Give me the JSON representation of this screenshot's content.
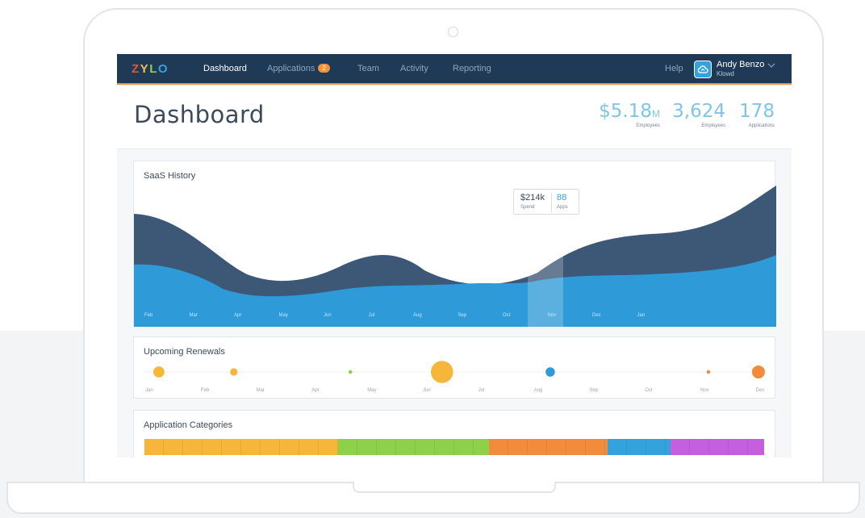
{
  "brand": {
    "logo_letters": [
      "Z",
      "Y",
      "L",
      "O"
    ],
    "logo_colors": [
      "#e9532f",
      "#f5c242",
      "#8ed04a",
      "#34a3dd"
    ]
  },
  "nav": {
    "items": [
      {
        "label": "Dashboard",
        "active": true
      },
      {
        "label": "Applications",
        "badge": "2"
      },
      {
        "label": "Team"
      },
      {
        "label": "Activity"
      },
      {
        "label": "Reporting"
      }
    ],
    "help": "Help",
    "user": {
      "name": "Andy Benzo",
      "org": "Klowd",
      "avatar_icon": "cloud-icon"
    },
    "accent": "#f0943c"
  },
  "header": {
    "title": "Dashboard",
    "stats": [
      {
        "value": "$5.18",
        "unit": "M",
        "label": "Employees"
      },
      {
        "value": "3,624",
        "label": "Employees"
      },
      {
        "value": "178",
        "label": "Applications"
      }
    ]
  },
  "saas_history": {
    "title": "SaaS History",
    "months": [
      "Feb",
      "Mar",
      "Apr",
      "May",
      "Jun",
      "Jul",
      "Aug",
      "Sep",
      "Oct",
      "Nov",
      "Dec",
      "Jan"
    ],
    "tooltip": {
      "spend_value": "$214k",
      "spend_label": "Spend",
      "apps_value": "88",
      "apps_label": "Apps"
    },
    "colors": {
      "spend": "#3d5877",
      "apps": "#2f9ad8"
    }
  },
  "renewals": {
    "title": "Upcoming Renewals",
    "months": [
      "Jan",
      "Feb",
      "Mar",
      "Apr",
      "May",
      "Jun",
      "Jul",
      "Aug",
      "Sep",
      "Oct",
      "Nov",
      "Dec"
    ]
  },
  "categories": {
    "title": "Application Categories",
    "colors": [
      "#f6b63a",
      "#8ed04a",
      "#f28c3c",
      "#34a3dd",
      "#c45fe0"
    ]
  },
  "chart_data": [
    {
      "type": "area",
      "title": "SaaS History",
      "categories": [
        "Feb",
        "Mar",
        "Apr",
        "May",
        "Jun",
        "Jul",
        "Aug",
        "Sep",
        "Oct",
        "Nov",
        "Dec",
        "Jan"
      ],
      "highlight": "Nov",
      "tooltip": {
        "Spend": "$214k",
        "Apps": "88"
      }
    },
    {
      "type": "scatter",
      "title": "Upcoming Renewals",
      "categories": [
        "Jan",
        "Feb",
        "Mar",
        "Apr",
        "May",
        "Jun",
        "Jul",
        "Aug",
        "Sep",
        "Oct",
        "Nov",
        "Dec"
      ],
      "points": [
        {
          "month": 0.1,
          "size": 3,
          "color": "#f6b63a"
        },
        {
          "month": 1.45,
          "size": 2,
          "color": "#f6b63a"
        },
        {
          "month": 3.55,
          "size": 1,
          "color": "#8ed04a"
        },
        {
          "month": 5.2,
          "size": 6,
          "color": "#f6b63a"
        },
        {
          "month": 7.15,
          "size": 2.5,
          "color": "#2f9ad8"
        },
        {
          "month": 10.0,
          "size": 1,
          "color": "#f28c3c"
        },
        {
          "month": 10.9,
          "size": 3.5,
          "color": "#f28c3c"
        }
      ]
    },
    {
      "type": "bar",
      "title": "Application Categories",
      "orientation": "stacked-horizontal",
      "values": [
        31,
        24,
        19,
        10,
        15
      ],
      "colors": [
        "#f6b63a",
        "#8ed04a",
        "#f28c3c",
        "#34a3dd",
        "#c45fe0"
      ]
    }
  ]
}
